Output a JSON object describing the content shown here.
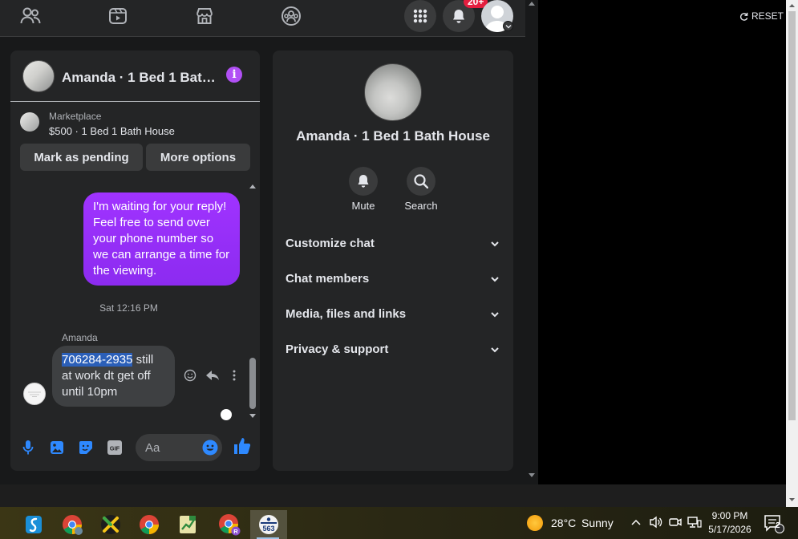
{
  "topnav": {
    "icons": [
      "friends-icon",
      "watch-icon",
      "marketplace-icon",
      "groups-icon",
      "menu-grid-icon",
      "bell-icon"
    ],
    "notification_badge": "20+"
  },
  "chat": {
    "title": "Amanda · 1 Bed 1 Bath House",
    "marketplace_label": "Marketplace",
    "listing": "$500 · 1 Bed 1 Bath House",
    "mark_pending_label": "Mark as pending",
    "more_options_label": "More options",
    "messages": {
      "outgoing": "I'm waiting for your reply! Feel free to send over your phone number so we can arrange a time for the viewing.",
      "timestamp": "Sat 12:16 PM",
      "sender": "Amanda",
      "incoming_highlight": "706284-2935",
      "incoming_rest": " still at work dt get off until 10pm"
    },
    "composer_placeholder": "Aa",
    "gif_label": "GIF"
  },
  "details": {
    "title": "Amanda · 1 Bed 1 Bath House",
    "mute_label": "Mute",
    "search_label": "Search",
    "sections": [
      "Customize chat",
      "Chat members",
      "Media, files and links",
      "Privacy & support"
    ]
  },
  "reset_label": "RESET",
  "taskbar": {
    "apps": [
      "swiftkey",
      "chrome-profile-1",
      "xmind",
      "chrome",
      "spreadsheet",
      "chrome-profile-r",
      "app-563"
    ],
    "app_563_label": "563",
    "profile_letter": "R",
    "temperature": "28°C",
    "weather": "Sunny",
    "time": "9:00 PM",
    "date": "5/17/2026",
    "notifications_count": "2"
  },
  "colors": {
    "accent_purple": "#a033ff",
    "messenger_blue": "#2e89ff",
    "badge_red": "#e41e3f"
  }
}
